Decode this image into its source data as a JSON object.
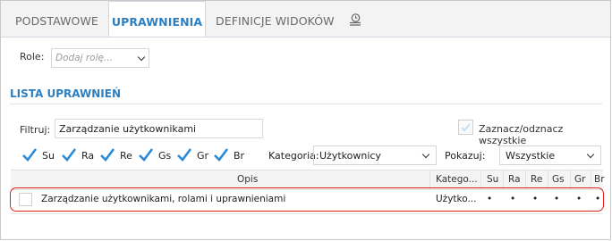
{
  "tabs": [
    "PODSTAWOWE",
    "UPRAWNIENIA",
    "DEFINICJE WIDOKÓW"
  ],
  "active_tab": "UPRAWNIENIA",
  "role": {
    "label": "Role:",
    "placeholder": "Dodaj rolę..."
  },
  "section_title": "LISTA UPRAWNIEŃ",
  "filter": {
    "label": "Filtruj:",
    "value": "Zarządzanie użytkownikami"
  },
  "toggle_all_label": "Zaznacz/odznacz wszystkie",
  "checkboxes": [
    "Su",
    "Ra",
    "Re",
    "Gs",
    "Gr",
    "Br"
  ],
  "category": {
    "label": "Kategoria:",
    "value": "Użytkownicy"
  },
  "show": {
    "label": "Pokazuj:",
    "value": "Wszystkie"
  },
  "grid": {
    "headers": [
      "Opis",
      "Katego...",
      "Su",
      "Ra",
      "Re",
      "Gs",
      "Gr",
      "Br"
    ],
    "rows": [
      {
        "opis": "Zarządzanie użytkownikami, rolami i uprawnieniami",
        "kategoria": "Użytko...",
        "flags": [
          "•",
          "•",
          "•",
          "•",
          "•",
          "•"
        ]
      }
    ]
  },
  "colors": {
    "accent": "#2f7fbf",
    "highlight": "#e0201e",
    "check": "#2b8ad8"
  }
}
